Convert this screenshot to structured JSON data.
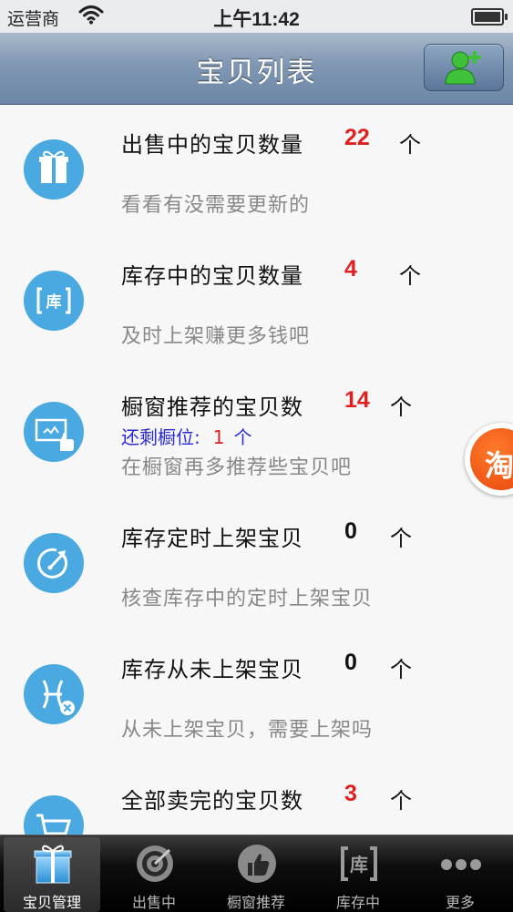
{
  "status_bar": {
    "carrier": "运营商",
    "time": "上午11:42"
  },
  "nav": {
    "title": "宝贝列表"
  },
  "items": [
    {
      "title": "出售中的宝贝数量",
      "count": "22",
      "unit": "个",
      "subtitle": "看看有没需要更新的",
      "icon": "gift-box-icon"
    },
    {
      "title": "库存中的宝贝数量",
      "count": "4",
      "unit": "个",
      "subtitle": "及时上架赚更多钱吧",
      "icon": "warehouse-icon"
    },
    {
      "title": "橱窗推荐的宝贝数",
      "count": "14",
      "unit": "个",
      "remain_label": "还剩橱位:",
      "remain_count": "1",
      "remain_unit": "个",
      "subtitle": "在橱窗再多推荐些宝贝吧",
      "icon": "showcase-thumb-icon"
    },
    {
      "title": "库存定时上架宝贝",
      "count": "0",
      "unit": "个",
      "subtitle": "核查库存中的定时上架宝贝",
      "icon": "timer-arrow-icon"
    },
    {
      "title": "库存从未上架宝贝",
      "count": "0",
      "unit": "个",
      "subtitle": "从未上架宝贝，需要上架吗",
      "icon": "pisces-x-icon"
    },
    {
      "title": "全部卖完的宝贝数",
      "count": "3",
      "unit": "个",
      "subtitle": "",
      "icon": "cart-icon"
    }
  ],
  "float_badge": {
    "glyph": "淘"
  },
  "tabs": [
    {
      "label": "宝贝管理",
      "icon": "gift-box-icon",
      "active": true
    },
    {
      "label": "出售中",
      "icon": "target-icon"
    },
    {
      "label": "橱窗推荐",
      "icon": "thumbs-up-icon"
    },
    {
      "label": "库存中",
      "icon": "warehouse-icon",
      "glyph": "库"
    },
    {
      "label": "更多",
      "icon": "more-dots-icon"
    }
  ],
  "colors": {
    "accent_red": "#e02020",
    "icon_blue": "#49a9e0",
    "remain_blue": "#2a2ad4"
  }
}
